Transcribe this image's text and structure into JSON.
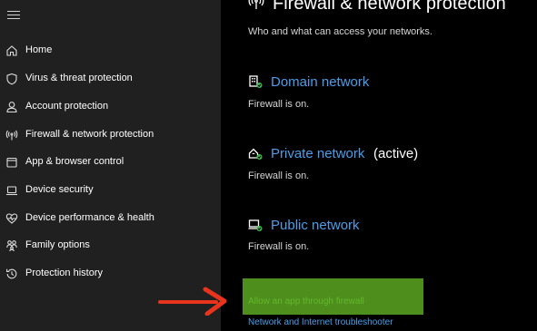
{
  "sidebar": {
    "items": [
      {
        "label": "Home",
        "icon": "home-icon"
      },
      {
        "label": "Virus & threat protection",
        "icon": "shield-icon"
      },
      {
        "label": "Account protection",
        "icon": "person-icon"
      },
      {
        "label": "Firewall & network protection",
        "icon": "antenna-icon"
      },
      {
        "label": "App & browser control",
        "icon": "app-window-icon"
      },
      {
        "label": "Device security",
        "icon": "laptop-icon"
      },
      {
        "label": "Device performance & health",
        "icon": "heart-pulse-icon"
      },
      {
        "label": "Family options",
        "icon": "family-icon"
      },
      {
        "label": "Protection history",
        "icon": "history-icon"
      }
    ]
  },
  "main": {
    "title": "Firewall & network protection",
    "subtitle": "Who and what can access your networks.",
    "networks": [
      {
        "name": "Domain network",
        "status": "Firewall is on.",
        "active": "",
        "icon": "domain-network-icon"
      },
      {
        "name": "Private network",
        "status": "Firewall is on.",
        "active": "(active)",
        "icon": "private-network-icon"
      },
      {
        "name": "Public network",
        "status": "Firewall is on.",
        "active": "",
        "icon": "public-network-icon"
      }
    ],
    "links": {
      "allow_app": "Allow an app through firewall",
      "troubleshooter": "Network and Internet troubleshooter"
    }
  },
  "colors": {
    "sidebar_bg": "#202020",
    "main_bg": "#000000",
    "link_blue": "#4a9eea",
    "highlight_green": "#4e8e1d",
    "arrow_red": "#e8341c",
    "status_ok": "#3fb950"
  }
}
